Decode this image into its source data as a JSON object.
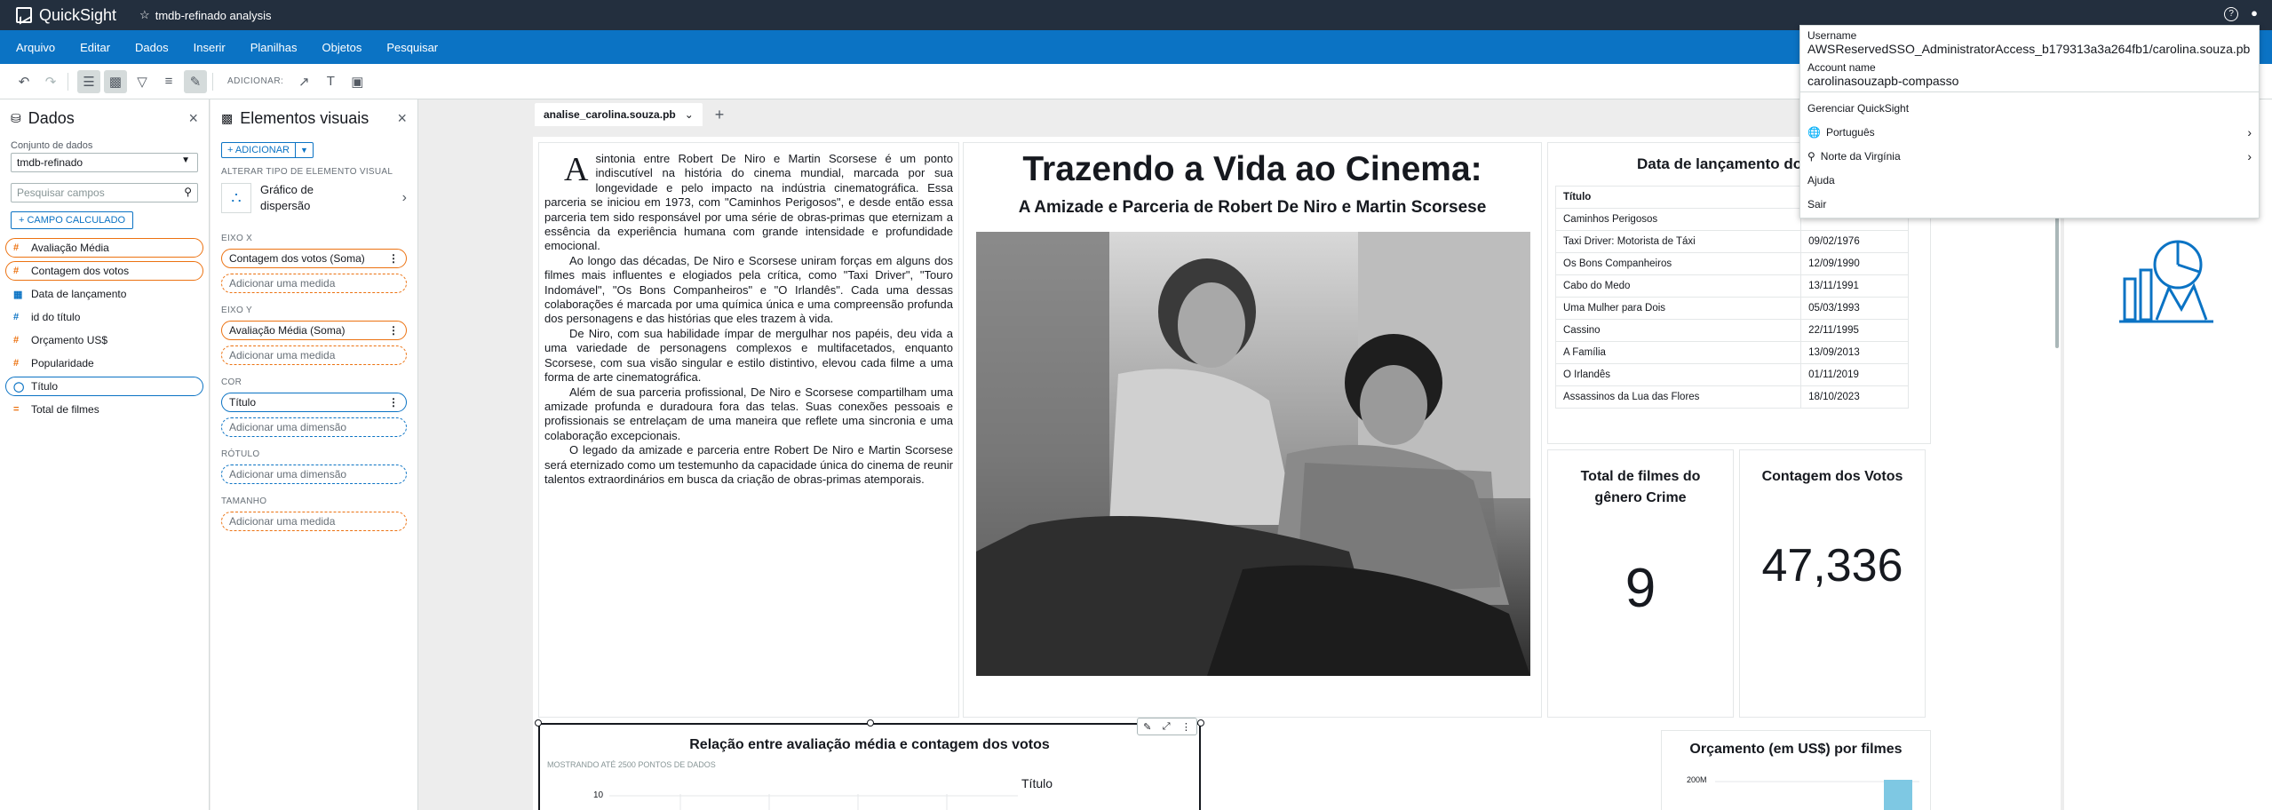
{
  "app": {
    "name": "QuickSight",
    "analysis_title": "tmdb-refinado analysis"
  },
  "menu": [
    "Arquivo",
    "Editar",
    "Dados",
    "Inserir",
    "Planilhas",
    "Objetos",
    "Pesquisar"
  ],
  "toolbar": {
    "add_label": "ADICIONAR:"
  },
  "data_panel": {
    "title": "Dados",
    "dataset_label": "Conjunto de dados",
    "dataset_value": "tmdb-refinado",
    "search_placeholder": "Pesquisar campos",
    "calc_button": "+ CAMPO CALCULADO",
    "fields": [
      {
        "label": "Avaliação Média",
        "type": "measure",
        "selected": true
      },
      {
        "label": "Contagem dos votos",
        "type": "measure",
        "selected": true
      },
      {
        "label": "Data de lançamento",
        "type": "date",
        "selected": false
      },
      {
        "label": "id do título",
        "type": "measure",
        "selected": false
      },
      {
        "label": "Orçamento US$",
        "type": "measure",
        "selected": false
      },
      {
        "label": "Popularidade",
        "type": "measure",
        "selected": false
      },
      {
        "label": "Título",
        "type": "dimension",
        "selected": true
      },
      {
        "label": "Total de filmes",
        "type": "calc",
        "selected": false
      }
    ]
  },
  "visuals_panel": {
    "title": "Elementos visuais",
    "add_button": "+ ADICIONAR",
    "change_type_label": "ALTERAR TIPO DE ELEMENTO VISUAL",
    "visual_type": "Gráfico de dispersão",
    "x_axis": {
      "label": "EIXO X",
      "value": "Contagem dos votos (Soma)",
      "empty": "Adicionar uma medida"
    },
    "y_axis": {
      "label": "EIXO Y",
      "value": "Avaliação Média (Soma)",
      "empty": "Adicionar uma medida"
    },
    "color": {
      "label": "COR",
      "value": "Título",
      "empty": "Adicionar uma dimensão"
    },
    "label": {
      "label": "RÓTULO",
      "empty": "Adicionar uma dimensão"
    },
    "size": {
      "label": "TAMANHO",
      "empty": "Adicionar uma medida"
    }
  },
  "sheet": {
    "tab": "analise_carolina.souza.pb",
    "text_dropcap": "A",
    "paragraphs": [
      "sintonia entre Robert De Niro e Martin Scorsese é um ponto indiscutível na história do cinema mundial, marcada por sua longevidade e pelo impacto na indústria cinematográfica. Essa parceria se iniciou em 1973, com \"Caminhos Perigosos\", e desde então essa parceria tem sido responsável por uma série de obras-primas que eternizam a essência da experiência humana com grande intensidade e profundidade emocional.",
      "Ao longo das décadas, De Niro e Scorsese uniram forças em alguns dos filmes mais influentes e elogiados pela crítica, como \"Taxi Driver\", \"Touro Indomável\", \"Os Bons Companheiros\" e \"O Irlandês\". Cada uma dessas colaborações é marcada por uma química única e uma compreensão profunda dos personagens e das histórias que eles trazem à vida.",
      "De Niro, com sua habilidade ímpar de mergulhar nos papéis, deu vida a uma variedade de personagens complexos e multifacetados, enquanto Scorsese, com sua visão singular e estilo distintivo, elevou cada filme a uma forma de arte cinematográfica.",
      "Além de sua parceria profissional, De Niro e Scorsese compartilham uma amizade profunda e duradoura fora das telas. Suas conexões pessoais e profissionais se entrelaçam de uma maneira que reflete uma sincronia e uma colaboração excepcionais.",
      "O legado da amizade e parceria entre Robert De Niro e Martin Scorsese será eternizado como um testemunho da capacidade única do cinema de reunir talentos extraordinários em busca da criação de obras-primas atemporais."
    ],
    "headline": "Trazendo a Vida ao Cinema:",
    "subheadline": "A Amizade e Parceria de Robert De Niro e Martin Scorsese",
    "release_table": {
      "title": "Data de lançamento do",
      "col_title": "Título",
      "rows": [
        {
          "title": "Caminhos Perigosos",
          "date": ""
        },
        {
          "title": "Taxi Driver: Motorista de Táxi",
          "date": "09/02/1976"
        },
        {
          "title": "Os Bons Companheiros",
          "date": "12/09/1990"
        },
        {
          "title": "Cabo do Medo",
          "date": "13/11/1991"
        },
        {
          "title": "Uma Mulher para Dois",
          "date": "05/03/1993"
        },
        {
          "title": "Cassino",
          "date": "22/11/1995"
        },
        {
          "title": "A Família",
          "date": "13/09/2013"
        },
        {
          "title": "O Irlandês",
          "date": "01/11/2019"
        },
        {
          "title": "Assassinos da Lua das Flores",
          "date": "18/10/2023"
        }
      ]
    },
    "kpi_films": {
      "title": "Total de filmes do gênero Crime",
      "value": "9"
    },
    "kpi_votes": {
      "title": "Contagem dos Votos",
      "value": "47,336"
    },
    "scatter": {
      "title": "Relação entre avaliação média e contagem dos votos",
      "subtitle": "MOSTRANDO ATÉ 2500 PONTOS DE DADOS",
      "y_tick": "10",
      "legend_title": "Título"
    },
    "budget": {
      "title": "Orçamento (em US$) por filmes",
      "y_tick": "200M"
    }
  },
  "account": {
    "username_label": "Username",
    "username": "AWSReservedSSO_AdministratorAccess_b179313a3a264fb1/carolina.souza.pb",
    "account_label": "Account name",
    "account": "carolinasouzapb-compasso",
    "manage": "Gerenciar QuickSight",
    "language": "Português",
    "region": "Norte da Virgínia",
    "help": "Ajuda",
    "signout": "Sair"
  }
}
